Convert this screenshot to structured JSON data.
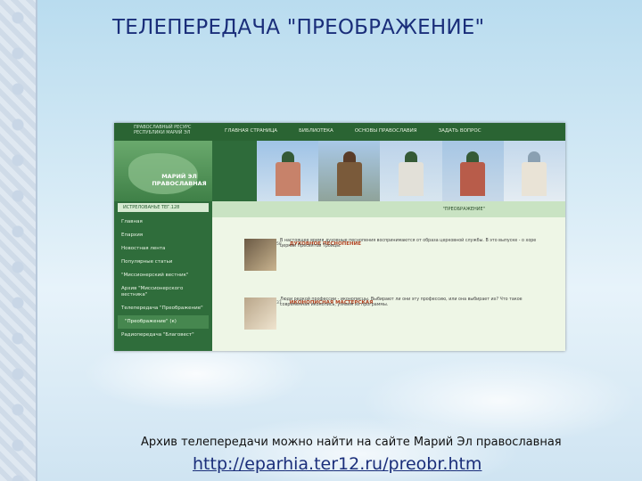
{
  "slide": {
    "title": "ТЕЛЕПЕРЕДАЧА \"ПРЕОБРАЖЕНИЕ\"",
    "caption": "Архив телепередачи можно найти на сайте Марий Эл православная",
    "link": "http://eparhia.ter12.ru/preobr.htm"
  },
  "site": {
    "org_text": "ПРАВОСЛАВНЫЙ РЕСУРС РЕСПУБЛИКИ МАРИЙ ЭЛ",
    "logo_text": "МАРИЙ ЭЛ ПРАВОСЛАВНАЯ",
    "nav": [
      "ГЛАВНАЯ СТРАНИЦА",
      "БИБЛИОТЕКА",
      "ОСНОВЫ ПРАВОСЛАВИЯ",
      "ЗАДАТЬ ВОПРОС"
    ],
    "strip_label": "\"ПРЕОБРАЖЕНИЕ\"",
    "sidebar_header": "ИСТРЕЛОВАНЬЕ ТЕГ.128",
    "sidebar": [
      "Главная",
      "Епархия",
      "Новостная лента",
      "Популярные статьи",
      "\"Миссионерский вестник\"",
      "Архив \"Миссионерского вестника\"",
      "Телепередача \"Преображение\"",
      "\"Преображение\" (к)",
      "Радиопередача \"Благовест\""
    ],
    "posts": [
      {
        "date": "08.11.14 10:29:58",
        "title": "ДУХОВНОЕ ПЕСНОПЕНИЕ",
        "text": "В настоящее время духовные песнопения воспринимаются от образа церковной службы. В это выпуске - о хоре церкви Пресвятой Троицы."
      },
      {
        "date": "08.11.14 10:07:37",
        "title": "ИКОНОПИСНАЯ МАСТЕРСКАЯ",
        "text": "Люди редкой профессии - иконописцы. Выбирают ли они эту профессию, или она выбирает их? Что такое современная иконопись, узнаем из программы."
      }
    ]
  }
}
